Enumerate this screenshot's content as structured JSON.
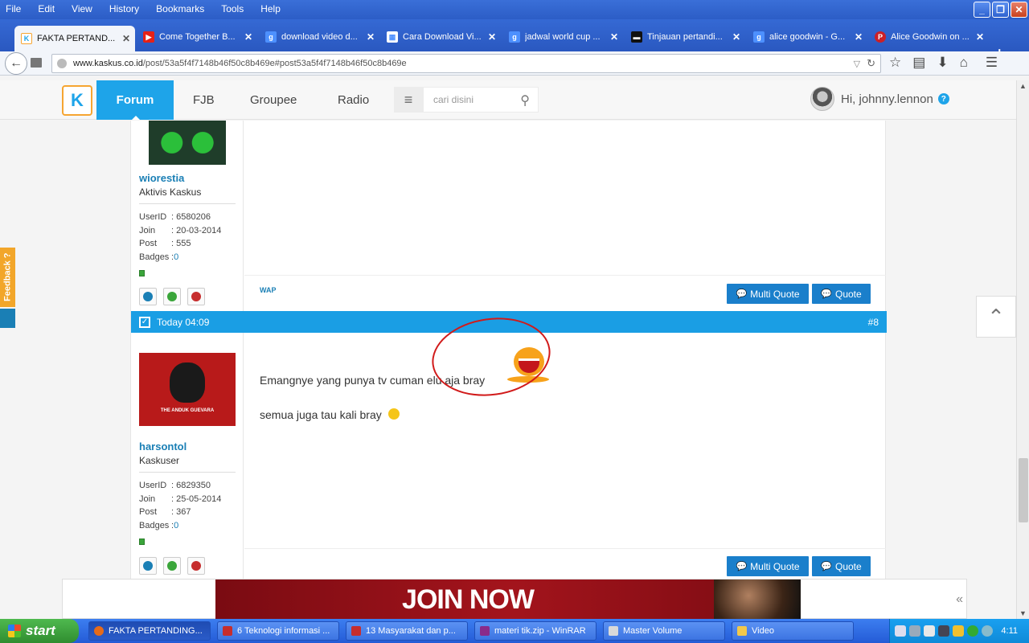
{
  "browser": {
    "menu": [
      "File",
      "Edit",
      "View",
      "History",
      "Bookmarks",
      "Tools",
      "Help"
    ],
    "tabs": [
      {
        "title": "FAKTA PERTAND...",
        "icon": "kaskus-icon",
        "color": "#1ea4e9"
      },
      {
        "title": "Come Together B...",
        "icon": "youtube-icon",
        "color": "#e62117"
      },
      {
        "title": "download video d...",
        "icon": "google-icon",
        "color": "#4d90fe"
      },
      {
        "title": "Cara Download Vi...",
        "icon": "page-icon",
        "color": "#ffffff"
      },
      {
        "title": "jadwal world cup ...",
        "icon": "google-icon",
        "color": "#4d90fe"
      },
      {
        "title": "Tinjauan pertandi...",
        "icon": "site-icon",
        "color": "#111111"
      },
      {
        "title": "alice goodwin - G...",
        "icon": "google-icon",
        "color": "#4d90fe"
      },
      {
        "title": "Alice Goodwin on ...",
        "icon": "pinterest-icon",
        "color": "#cb2027"
      }
    ],
    "url_domain": "www.kaskus.co.id",
    "url_path": "/post/53a5f4f7148b46f50c8b469e#post53a5f4f7148b46f50c8b469e"
  },
  "header": {
    "nav": [
      "Forum",
      "FJB",
      "Groupee",
      "Radio"
    ],
    "search_placeholder": "cari disini",
    "greeting": "Hi, johnny.lennon",
    "help": "?"
  },
  "posts": [
    {
      "username": "wiorestia",
      "rank": "Aktivis Kaskus",
      "stats": [
        {
          "k": "UserID",
          "v": ": 6580206"
        },
        {
          "k": "Join",
          "v": ": 20-03-2014"
        },
        {
          "k": "Post",
          "v": ": 555"
        },
        {
          "k": "Badges",
          "v": ": ",
          "link": "0"
        }
      ],
      "wap": "WAP"
    },
    {
      "time": "Today 04:09",
      "number": "#8",
      "username": "harsontol",
      "rank": "Kaskuser",
      "avatar_caption": "THE ANDUK GUEVARA",
      "stats": [
        {
          "k": "UserID",
          "v": ": 6829350"
        },
        {
          "k": "Join",
          "v": ": 25-05-2014"
        },
        {
          "k": "Post",
          "v": ": 367"
        },
        {
          "k": "Badges",
          "v": ": ",
          "link": "0"
        }
      ],
      "lines": [
        "Emangnye yang punya tv cuman elu aja bray",
        "semua juga tau kali bray"
      ]
    }
  ],
  "buttons": {
    "multi_quote": "Multi Quote",
    "quote": "Quote"
  },
  "feedback": "Feedback ?",
  "ad": {
    "text": "JOIN NOW"
  },
  "taskbar": {
    "start": "start",
    "tasks": [
      {
        "title": "FAKTA PERTANDING...",
        "color": "#e66b1a"
      },
      {
        "title": "6 Teknologi informasi ...",
        "color": "#c62d2d"
      },
      {
        "title": "13 Masyarakat dan p...",
        "color": "#c62d2d"
      },
      {
        "title": "materi tik.zip - WinRAR",
        "color": "#8a2b8a"
      },
      {
        "title": "Master Volume",
        "color": "#d9d9d9"
      },
      {
        "title": "Video",
        "color": "#f2c84b"
      }
    ],
    "clock": "4:11"
  }
}
